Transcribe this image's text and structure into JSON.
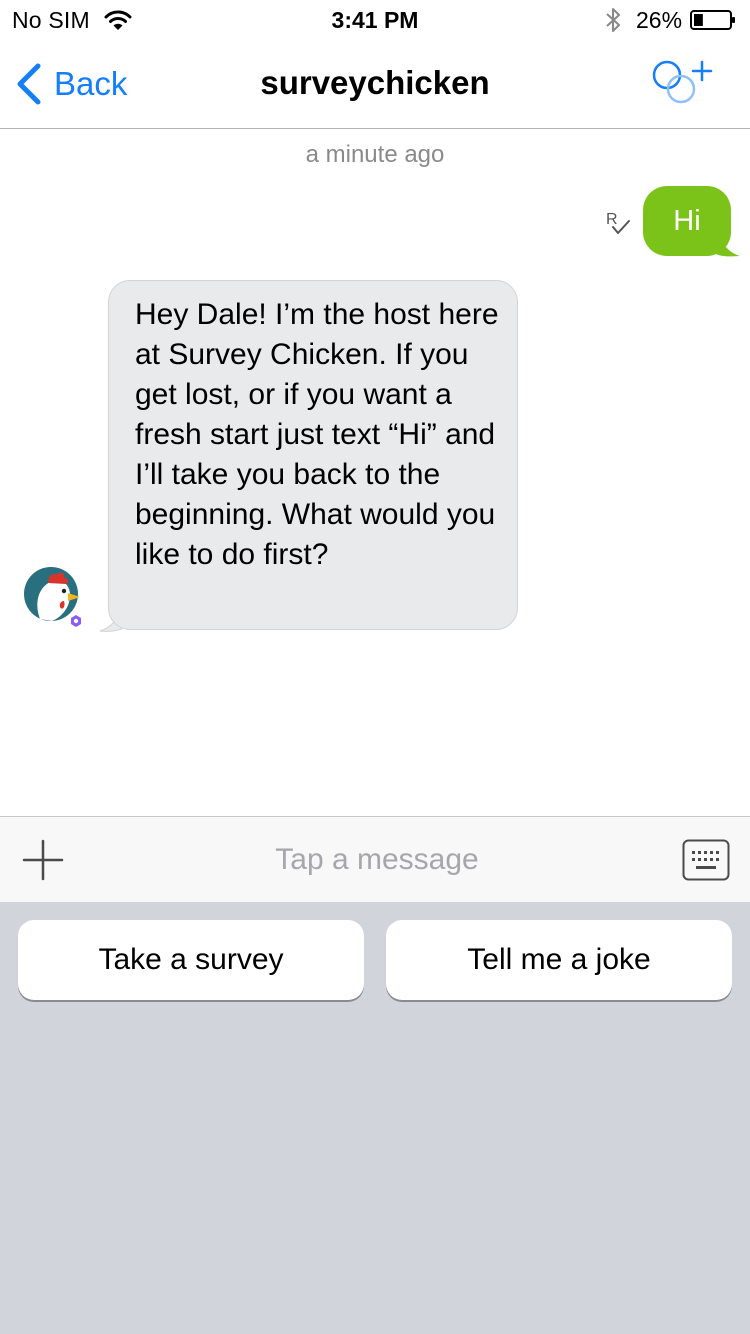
{
  "status_bar": {
    "carrier": "No SIM",
    "time": "3:41 PM",
    "battery_percent": "26%",
    "battery_level": 0.26,
    "icons": [
      "wifi-icon",
      "bluetooth-icon",
      "battery-icon"
    ]
  },
  "nav": {
    "back_label": "Back",
    "title": "surveychicken",
    "icons": [
      "chevron-left-icon",
      "add-people-icon"
    ]
  },
  "conversation": {
    "timestamp": "a minute ago",
    "outgoing_message": "Hi",
    "read_receipt": "R",
    "incoming_message": "Hey Dale! I’m the host here at Survey Chicken. If you get lost, or if you want a fresh start just text “Hi” and I’ll take you back to the beginning. What would you like to do first?",
    "avatar_icon": "chicken-avatar"
  },
  "input_bar": {
    "placeholder": "Tap a message",
    "value": "",
    "icons": [
      "plus-icon",
      "keyboard-icon"
    ]
  },
  "quick_replies": [
    {
      "label": "Take a survey"
    },
    {
      "label": "Tell me a joke"
    }
  ],
  "colors": {
    "accent": "#147efb",
    "outgoing_bubble": "#7cc319",
    "incoming_bubble": "#e9eaec",
    "keyboard_area": "#d1d4da"
  }
}
